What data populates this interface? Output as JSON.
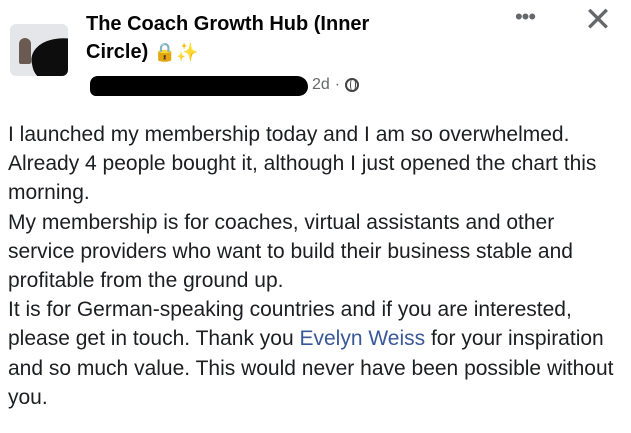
{
  "header": {
    "group_title": "The Coach Growth Hub (Inner Circle)",
    "lock_icon": "🔒",
    "sparkle_icon": "✨",
    "time": "2d",
    "separator": "·",
    "audience_icon": "globe-icon"
  },
  "actions": {
    "more": "•••",
    "close": "✕"
  },
  "post": {
    "p1": "I launched my membership today and I am so overwhelmed. Already 4 people bought it, although I just opened the chart this morning.",
    "p2": "My membership is for coaches, virtual assistants and other service providers who want to build their business stable and profitable from the ground up.",
    "p3_before": "It is for German-speaking countries and if you are interested, please get in touch. Thank you ",
    "mention": "Evelyn Weiss",
    "p3_after": " for your inspiration and so much value. This would never have been possible without you."
  },
  "colors": {
    "mention": "#385898",
    "text": "#1c1e21",
    "meta": "#65676b"
  }
}
